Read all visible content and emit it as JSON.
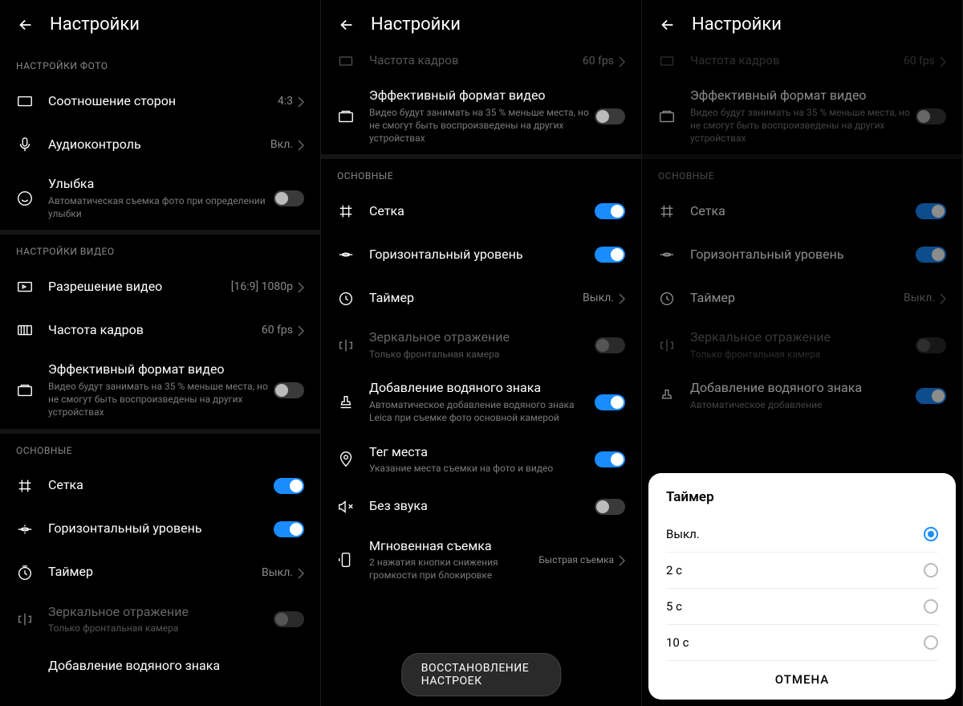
{
  "header": {
    "title": "Настройки"
  },
  "photo": {
    "section": "НАСТРОЙКИ ФОТО",
    "aspect_ratio": {
      "label": "Соотношение сторон",
      "value": "4:3"
    },
    "audio_control": {
      "label": "Аудиоконтроль",
      "value": "Вкл."
    },
    "smile": {
      "label": "Улыбка",
      "desc": "Автоматическая съемка фото при определении улыбки"
    }
  },
  "video": {
    "section": "НАСТРОЙКИ ВИДЕО",
    "resolution": {
      "label": "Разрешение видео",
      "value": "[16:9] 1080p"
    },
    "fps": {
      "label": "Частота кадров",
      "value": "60 fps"
    },
    "fps_cut_value": "60 fps",
    "efficient": {
      "label": "Эффективный формат видео",
      "desc": "Видео будут занимать на 35 % меньше места, но не смогут быть воспроизведены на других устройствах"
    }
  },
  "general": {
    "section": "ОСНОВНЫЕ",
    "grid": "Сетка",
    "level": "Горизонтальный уровень",
    "timer": {
      "label": "Таймер",
      "value": "Выкл."
    },
    "mirror": {
      "label": "Зеркальное отражение",
      "desc": "Только фронтальная камера"
    },
    "watermark": {
      "label": "Добавление водяного знака",
      "desc": "Автоматическое добавление водяного знака Leica при съемке фото основной камерой",
      "desc_short": "Автоматическое добавление"
    },
    "geo": {
      "label": "Тег места",
      "desc": "Указание места съемки на фото и видео"
    },
    "mute": "Без звука",
    "quick": {
      "label": "Мгновенная съемка",
      "desc": "2 нажатия кнопки снижения громкости при блокировке",
      "value": "Быстрая съемка"
    }
  },
  "restore": "ВОССТАНОВЛЕНИЕ НАСТРОЕК",
  "dialog": {
    "title": "Таймер",
    "opts": [
      "Выкл.",
      "2 с",
      "5 с",
      "10 с"
    ],
    "cancel": "ОТМЕНА"
  }
}
